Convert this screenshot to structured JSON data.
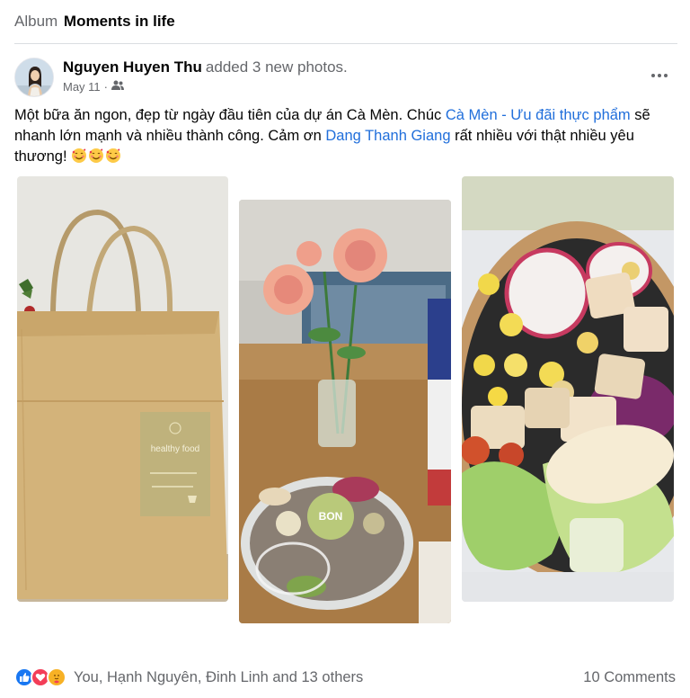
{
  "album": {
    "prefix": "Album",
    "title": "Moments in life"
  },
  "post": {
    "author": "Nguyen Huyen Thu",
    "action": "added 3 new photos.",
    "date": "May 11",
    "audience_icon": "friends-icon",
    "more_icon": "more-options-icon",
    "text": {
      "part1": "Một bữa ăn ngon, đẹp từ ngày đầu tiên của dự án Cà Mèn. Chúc ",
      "link1": "Cà Mèn - Ưu đãi thực phẩm",
      "part2": " sẽ nhanh lớn mạnh và nhiều thành công. Cảm ơn ",
      "link2": "Dang Thanh Giang",
      "part3": " rất nhiều với thật nhiều yêu thương! "
    },
    "emojis": [
      "smiling-face-with-hearts",
      "smiling-face-with-hearts",
      "smiling-face-with-hearts"
    ]
  },
  "photos": [
    {
      "name": "paper-bag-photo",
      "bag_label": "healthy food"
    },
    {
      "name": "flowers-salad-box-photo",
      "lid_label": "BON"
    },
    {
      "name": "salad-bowl-photo"
    }
  ],
  "footer": {
    "reaction_icons": [
      "like-icon",
      "love-icon",
      "care-icon"
    ],
    "reactions_text": "You, Hạnh Nguyên, Đinh Linh and 13 others",
    "comments_text": "10 Comments"
  },
  "colors": {
    "link": "#216fdb",
    "secondary_text": "#65676b",
    "like_blue": "#1877f2",
    "love_red": "#f33e58",
    "care_yellow": "#f7b125"
  }
}
